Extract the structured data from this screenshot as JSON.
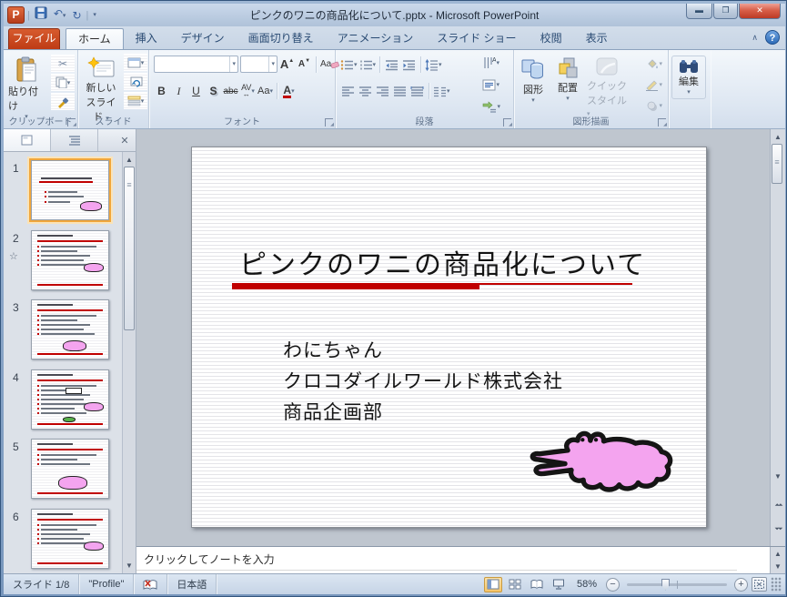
{
  "window": {
    "title": "ピンクのワニの商品化について.pptx  -  Microsoft PowerPoint"
  },
  "icons": {
    "undo": "↶",
    "redo": "↻",
    "dropdown": "▾",
    "qat_more": "▾",
    "minimize": "▬",
    "maximize": "❐",
    "close": "✕",
    "collapse_ribbon": "∧",
    "help": "?",
    "scissors": "✂",
    "panel_close": "✕",
    "scroll_up": "▲",
    "scroll_down": "▼",
    "prev_slide": "⏶⏶",
    "next_slide": "⏷⏷",
    "animation_star": "☆",
    "zoom_out": "−",
    "zoom_in": "+"
  },
  "ribbon": {
    "file_tab": "ファイル",
    "tabs": [
      {
        "label": "ホーム",
        "active": true
      },
      {
        "label": "挿入",
        "active": false
      },
      {
        "label": "デザイン",
        "active": false
      },
      {
        "label": "画面切り替え",
        "active": false
      },
      {
        "label": "アニメーション",
        "active": false
      },
      {
        "label": "スライド ショー",
        "active": false
      },
      {
        "label": "校閲",
        "active": false
      },
      {
        "label": "表示",
        "active": false
      }
    ],
    "clipboard": {
      "label": "クリップボード",
      "paste": "貼り付け"
    },
    "slides_group": {
      "label": "スライド",
      "new_slide_line1": "新しい",
      "new_slide_line2": "スライド"
    },
    "font": {
      "label": "フォント",
      "bold": "B",
      "italic": "I",
      "underline": "U",
      "shadow": "S",
      "strikethrough": "abc",
      "grow": "A",
      "shrink": "A",
      "clear": "Aa",
      "char_spacing": "AV",
      "change_case": "Aa",
      "font_color": "A"
    },
    "paragraph": {
      "label": "段落"
    },
    "drawing": {
      "label": "図形描画",
      "shapes": "図形",
      "arrange": "配置",
      "quick_styles_line1": "クイック",
      "quick_styles_line2": "スタイル"
    },
    "editing": {
      "label": "編集"
    }
  },
  "slide_panel": {
    "slides": [
      {
        "number": "1",
        "selected": true,
        "animated": false,
        "variant": "title",
        "croc": "right",
        "lines": 3
      },
      {
        "number": "2",
        "selected": false,
        "animated": true,
        "variant": "bullets",
        "croc": "right",
        "lines": 5
      },
      {
        "number": "3",
        "selected": false,
        "animated": false,
        "variant": "bullets",
        "croc": "center",
        "lines": 5
      },
      {
        "number": "4",
        "selected": false,
        "animated": false,
        "variant": "bullets",
        "croc": "right",
        "lines": 7,
        "extra": "green"
      },
      {
        "number": "5",
        "selected": false,
        "animated": false,
        "variant": "bullets",
        "croc": "center-large",
        "lines": 3
      },
      {
        "number": "6",
        "selected": false,
        "animated": false,
        "variant": "bullets",
        "croc": "right",
        "lines": 5
      }
    ]
  },
  "slide": {
    "title": "ピンクのワニの商品化について",
    "body_lines": [
      "わにちゃん",
      "クロコダイルワールド株式会社",
      "商品企画部"
    ]
  },
  "notes": {
    "placeholder": "クリックしてノートを入力"
  },
  "status_bar": {
    "slide_indicator": "スライド 1/8",
    "theme_name": "\"Profile\"",
    "language": "日本語",
    "zoom_level": "58%"
  },
  "colors": {
    "accent_red": "#C00000",
    "croc_pink": "#F4A4EF",
    "file_tab": "#BE3B15",
    "file_tab_light": "#D75B2E",
    "selection_orange": "#F0A63C"
  }
}
